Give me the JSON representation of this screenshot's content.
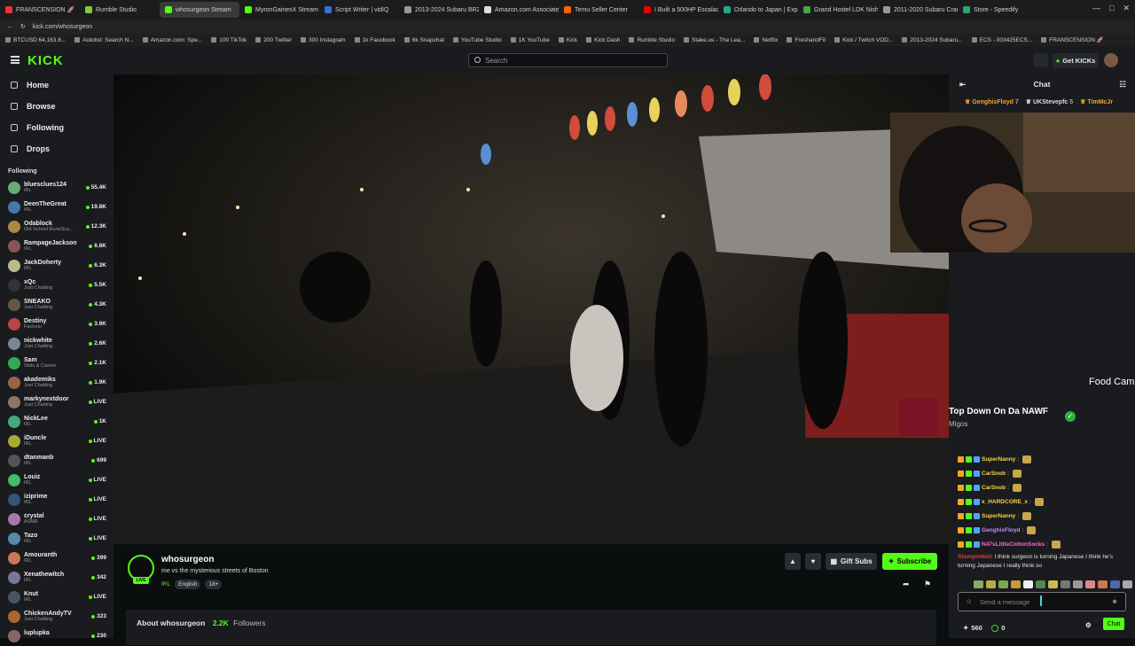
{
  "browser": {
    "tabs": [
      {
        "label": "FRANSCENSION 🚀",
        "color": "#e33"
      },
      {
        "label": "Rumble Studio",
        "color": "#85c742"
      },
      {
        "label": "whosurgeon Stream",
        "color": "#53fc18",
        "active": true
      },
      {
        "label": "MyronGainesX Stream",
        "color": "#53fc18"
      },
      {
        "label": "Script Writer | vidIQ",
        "color": "#3b6fd8"
      },
      {
        "label": "2013-2024 Subaru BRZ",
        "color": "#999"
      },
      {
        "label": "Amazon.com Associate",
        "color": "#ddd"
      },
      {
        "label": "Temu Seller Center",
        "color": "#f60"
      },
      {
        "label": "I Built a 500HP Escalade",
        "color": "#e00"
      },
      {
        "label": "Orlando to Japan | Expl",
        "color": "#2a8"
      },
      {
        "label": "Grand Hostel LDK Nishi",
        "color": "#4a4"
      },
      {
        "label": "2011-2020 Subaru Crank",
        "color": "#999"
      },
      {
        "label": "Store - Speedify",
        "color": "#2a6"
      }
    ],
    "url": "kick.com/whosurgeon",
    "bookmarks": [
      "BTCUSD 64,163.8...",
      "Autolist: Search N...",
      "Amazon.com: Spe...",
      "100 TikTok",
      "200 Twitter",
      "300 Instagram",
      "1k Facebook",
      "6k Snapchat",
      "YouTube Studio",
      "1K YouTube",
      "Kick",
      "Kick Dash",
      "Rumble Studio",
      "Stake.us - The Lea...",
      "Netflix",
      "FreshandFit",
      "Kick / Twitch VOD...",
      "2013-2024 Subaru...",
      "ECS - 003425ECS...",
      "FRANSCENSION 🚀"
    ]
  },
  "nav": {
    "logo": "KICK",
    "search_placeholder": "Search",
    "get_kicks": "Get KICKs",
    "items": [
      {
        "label": "Home"
      },
      {
        "label": "Browse"
      },
      {
        "label": "Following"
      },
      {
        "label": "Drops"
      }
    ]
  },
  "following": {
    "header": "Following",
    "channels": [
      {
        "name": "bluesclues124",
        "category": "IRL",
        "viewers": "55.4K",
        "color": "#6a7"
      },
      {
        "name": "DeenTheGreat",
        "category": "IRL",
        "viewers": "19.8K",
        "color": "#47a"
      },
      {
        "name": "Odablock",
        "category": "Old School RuneSca...",
        "viewers": "12.3K",
        "color": "#a84"
      },
      {
        "name": "RampageJackson",
        "category": "IRL",
        "viewers": "6.8K",
        "color": "#855"
      },
      {
        "name": "JackDoherty",
        "category": "IRL",
        "viewers": "6.3K",
        "color": "#bb8"
      },
      {
        "name": "xQc",
        "category": "Just Chatting",
        "viewers": "5.5K",
        "color": "#333"
      },
      {
        "name": "SNEAKO",
        "category": "Just Chatting",
        "viewers": "4.3K",
        "color": "#654"
      },
      {
        "name": "Destiny",
        "category": "Factorio",
        "viewers": "3.9K",
        "color": "#b44"
      },
      {
        "name": "nickwhite",
        "category": "Just Chatting",
        "viewers": "2.6K",
        "color": "#789"
      },
      {
        "name": "Sam",
        "category": "Slots & Casino",
        "viewers": "2.1K",
        "color": "#3a5"
      },
      {
        "name": "akademiks",
        "category": "Just Chatting",
        "viewers": "1.9K",
        "color": "#964"
      },
      {
        "name": "markynextdoor",
        "category": "Just Chatting",
        "viewers": "LIVE",
        "color": "#876"
      },
      {
        "name": "NickLee",
        "category": "IRL",
        "viewers": "1K",
        "color": "#4a7"
      },
      {
        "name": "iDuncle",
        "category": "IRL",
        "viewers": "LIVE",
        "color": "#aa3"
      },
      {
        "name": "dtanmanb",
        "category": "IRL",
        "viewers": "699",
        "color": "#555"
      },
      {
        "name": "Louiz",
        "category": "IRL",
        "viewers": "LIVE",
        "color": "#4b6"
      },
      {
        "name": "iziprime",
        "category": "IRL",
        "viewers": "LIVE",
        "color": "#357"
      },
      {
        "name": "crystal",
        "category": "ASMR",
        "viewers": "LIVE",
        "color": "#a7a"
      },
      {
        "name": "Tazo",
        "category": "IRL",
        "viewers": "LIVE",
        "color": "#58a"
      },
      {
        "name": "Amouranth",
        "category": "IRL",
        "viewers": "399",
        "color": "#c75"
      },
      {
        "name": "Xenathewitch",
        "category": "IRL",
        "viewers": "342",
        "color": "#779"
      },
      {
        "name": "Knut",
        "category": "IRL",
        "viewers": "LIVE",
        "color": "#456"
      },
      {
        "name": "ChickenAndyTV",
        "category": "Just Chatting",
        "viewers": "323",
        "color": "#a63"
      },
      {
        "name": "luplupka",
        "category": "",
        "viewers": "230",
        "color": "#866"
      }
    ]
  },
  "stream": {
    "channel": "whosurgeon",
    "live": "LIVE",
    "title": "me vs the mysterious streets of Boston",
    "category": "IRL",
    "tags": [
      "English",
      "18+"
    ],
    "gift_subs": "Gift Subs",
    "subscribe": "Subscribe",
    "about_label": "About whosurgeon",
    "followers_count": "2.2K",
    "followers_label": "Followers"
  },
  "chat": {
    "title": "Chat",
    "gifters": [
      {
        "name": "GenghisFloyd",
        "count": "7",
        "color": "#f5a623"
      },
      {
        "name": "UKStevepfc",
        "count": "5",
        "color": "#ddd"
      },
      {
        "name": "TimMcJr",
        "count": "",
        "color": "#f5a623"
      }
    ],
    "overlay_label": "Food Cam",
    "song": {
      "title": "Top Down On Da NAWF",
      "artist": "Migos"
    },
    "messages": [
      {
        "user": "SuperNanny",
        "color": "#f5d742"
      },
      {
        "user": "CarSnob",
        "color": "#f5d742"
      },
      {
        "user": "CarSnob",
        "color": "#f5d742"
      },
      {
        "user": "x_HARDCORE_x",
        "color": "#f5d742"
      },
      {
        "user": "SuperNanny",
        "color": "#f5d742"
      },
      {
        "user": "GenghisFloyd",
        "color": "#c78cff"
      },
      {
        "user": "N47sLittleCottonSocks",
        "color": "#ff6ad5"
      }
    ],
    "long_message": {
      "user": "StompinNeil",
      "color": "#e23d3d",
      "text": "I think surgeon is turning Japanese I think he's turning Japanese I really think so"
    },
    "input_placeholder": "Send a message",
    "kicks_count": "560",
    "points": "0",
    "send_label": "Chat"
  }
}
